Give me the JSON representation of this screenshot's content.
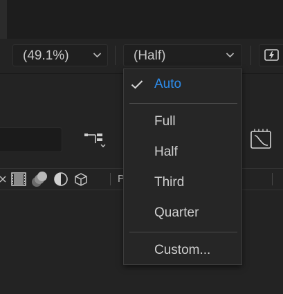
{
  "toolbar": {
    "magnification_value": "(49.1%)",
    "resolution_value": "(Half)"
  },
  "resolution_menu": {
    "selected": "Auto",
    "items": [
      {
        "label": "Auto",
        "selected": true
      },
      {
        "label": "Full",
        "selected": false
      },
      {
        "label": "Half",
        "selected": false
      },
      {
        "label": "Third",
        "selected": false
      },
      {
        "label": "Quarter",
        "selected": false
      },
      {
        "label": "Custom...",
        "selected": false
      }
    ]
  },
  "panel": {
    "column_header_partial": "P"
  },
  "colors": {
    "accent": "#2d8ceb",
    "panel_bg": "#232323",
    "menu_bg": "#262626"
  },
  "icons": [
    "chevron-down-icon",
    "fast-previews-icon",
    "flowchart-icon",
    "graph-editor-icon",
    "shy-icon",
    "frame-blending-icon",
    "motion-blur-icon",
    "adjustment-layer-icon",
    "3d-layer-icon",
    "checkmark-icon"
  ]
}
